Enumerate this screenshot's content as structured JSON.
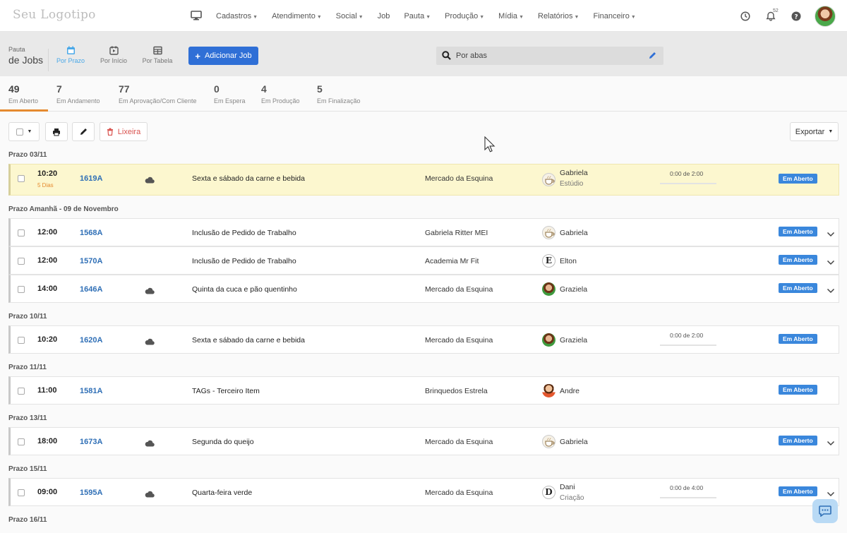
{
  "topnav": {
    "logo": "Seu Logotipo",
    "menu": [
      {
        "label": "Cadastros",
        "caret": true
      },
      {
        "label": "Atendimento",
        "caret": true
      },
      {
        "label": "Social",
        "caret": true
      },
      {
        "label": "Job",
        "caret": false
      },
      {
        "label": "Pauta",
        "caret": true
      },
      {
        "label": "Produção",
        "caret": true
      },
      {
        "label": "Mídia",
        "caret": true
      },
      {
        "label": "Relatórios",
        "caret": true
      },
      {
        "label": "Financeiro",
        "caret": true
      }
    ],
    "notification_count": "52"
  },
  "toolbar": {
    "title_small": "Pauta",
    "title_big": "de Jobs",
    "views": [
      {
        "label": "Por Prazo",
        "icon": "calendar-icon",
        "active": true
      },
      {
        "label": "Por Início",
        "icon": "play-calendar-icon",
        "active": false
      },
      {
        "label": "Por Tabela",
        "icon": "table-icon",
        "active": false
      }
    ],
    "add_label": "Adicionar Job",
    "search_label": "Por abas"
  },
  "stats": [
    {
      "num": "49",
      "label": "Em Aberto"
    },
    {
      "num": "7",
      "label": "Em Andamento"
    },
    {
      "num": "77",
      "label": "Em Aprovação/Com Cliente"
    },
    {
      "num": "0",
      "label": "Em Espera"
    },
    {
      "num": "4",
      "label": "Em Produção"
    },
    {
      "num": "5",
      "label": "Em Finalização"
    }
  ],
  "actions": {
    "trash_label": "Lixeira",
    "export_label": "Exportar"
  },
  "groups": [
    {
      "title": "Prazo 03/11",
      "rows": [
        {
          "time": "10:20",
          "late": "5 Dias",
          "code": "1619A",
          "cloud": true,
          "title": "Sexta e sábado da carne e bebida",
          "client": "Mercado da Esquina",
          "avatar": "cup",
          "user": "Gabriela",
          "dept": "Estúdio",
          "progress": "0:00 de 2:00",
          "progress_frac": 0,
          "status": "Em Aberto",
          "chevron": false,
          "highlight": true
        }
      ]
    },
    {
      "title": "Prazo Amanhã - 09 de Novembro",
      "rows": [
        {
          "time": "12:00",
          "code": "1568A",
          "cloud": false,
          "title": "Inclusão de Pedido de Trabalho",
          "client": "Gabriela Ritter MEI",
          "avatar": "cup",
          "user": "Gabriela",
          "status": "Em Aberto",
          "chevron": true
        },
        {
          "time": "12:00",
          "code": "1570A",
          "cloud": false,
          "title": "Inclusão de Pedido de Trabalho",
          "client": "Academia Mr Fit",
          "avatar": "e",
          "avatar_letter": "E",
          "user": "Elton",
          "status": "Em Aberto",
          "chevron": true
        },
        {
          "time": "14:00",
          "code": "1646A",
          "cloud": true,
          "title": "Quinta da cuca e pão quentinho",
          "client": "Mercado da Esquina",
          "avatar": "photo",
          "user": "Graziela",
          "status": "Em Aberto",
          "chevron": true
        }
      ]
    },
    {
      "title": "Prazo 10/11",
      "rows": [
        {
          "time": "10:20",
          "code": "1620A",
          "cloud": true,
          "title": "Sexta e sábado da carne e bebida",
          "client": "Mercado da Esquina",
          "avatar": "photo",
          "user": "Graziela",
          "progress": "0:00 de 2:00",
          "progress_frac": 0,
          "status": "Em Aberto",
          "chevron": false
        }
      ]
    },
    {
      "title": "Prazo 11/11",
      "rows": [
        {
          "time": "11:00",
          "code": "1581A",
          "cloud": false,
          "title": "TAGs - Terceiro Item",
          "client": "Brinquedos Estrela",
          "avatar": "andre",
          "user": "Andre",
          "status": "Em Aberto",
          "chevron": false
        }
      ]
    },
    {
      "title": "Prazo 13/11",
      "rows": [
        {
          "time": "18:00",
          "code": "1673A",
          "cloud": true,
          "title": "Segunda do queijo",
          "client": "Mercado da Esquina",
          "avatar": "cup",
          "user": "Gabriela",
          "status": "Em Aberto",
          "chevron": true
        }
      ]
    },
    {
      "title": "Prazo 15/11",
      "rows": [
        {
          "time": "09:00",
          "code": "1595A",
          "cloud": true,
          "title": "Quarta-feira verde",
          "client": "Mercado da Esquina",
          "avatar": "d",
          "avatar_letter": "D",
          "user": "Dani",
          "dept": "Criação",
          "progress": "0:00 de 4:00",
          "progress_frac": 0,
          "status": "Em Aberto",
          "chevron": true
        }
      ]
    },
    {
      "title": "Prazo 16/11",
      "rows": []
    }
  ]
}
